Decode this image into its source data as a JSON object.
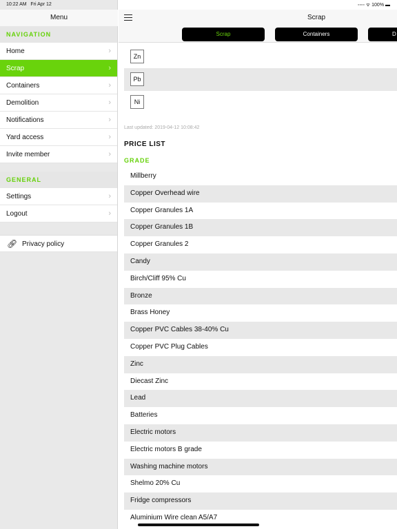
{
  "status": {
    "time": "10:22 AM",
    "date": "Fri Apr 12",
    "battery": "100%"
  },
  "sidebar": {
    "title": "Menu",
    "navigation_label": "NAVIGATION",
    "nav_items": [
      {
        "label": "Home"
      },
      {
        "label": "Scrap",
        "active": true
      },
      {
        "label": "Containers"
      },
      {
        "label": "Demolition"
      },
      {
        "label": "Notifications"
      },
      {
        "label": "Yard access"
      },
      {
        "label": "Invite member"
      }
    ],
    "general_label": "GENERAL",
    "general_items": [
      {
        "label": "Settings"
      },
      {
        "label": "Logout"
      }
    ],
    "privacy": "Privacy policy"
  },
  "header": {
    "title": "Scrap",
    "tabs": [
      "Scrap",
      "Containers",
      "D"
    ]
  },
  "elements": [
    "Zn",
    "Pb",
    "Ni"
  ],
  "last_updated": "Last updated: 2019-04-12 10:08:42",
  "price_list": "PRICE LIST",
  "grade_label": "GRADE",
  "grades": [
    "Millberry",
    "Copper Overhead wire",
    "Copper Granules 1A",
    "Copper Granules 1B",
    "Copper Granules 2",
    "Candy",
    "Birch/Cliff 95% Cu",
    "Bronze",
    "Brass Honey",
    "Copper PVC Cables 38-40% Cu",
    "Copper PVC Plug Cables",
    "Zinc",
    "Diecast Zinc",
    "Lead",
    "Batteries",
    "Electric motors",
    "Electric motors B grade",
    "Washing machine motors",
    "Shelmo 20% Cu",
    "Fridge compressors",
    "Aluminium Wire clean A5/A7"
  ],
  "colors": {
    "accent": "#69d30c"
  }
}
